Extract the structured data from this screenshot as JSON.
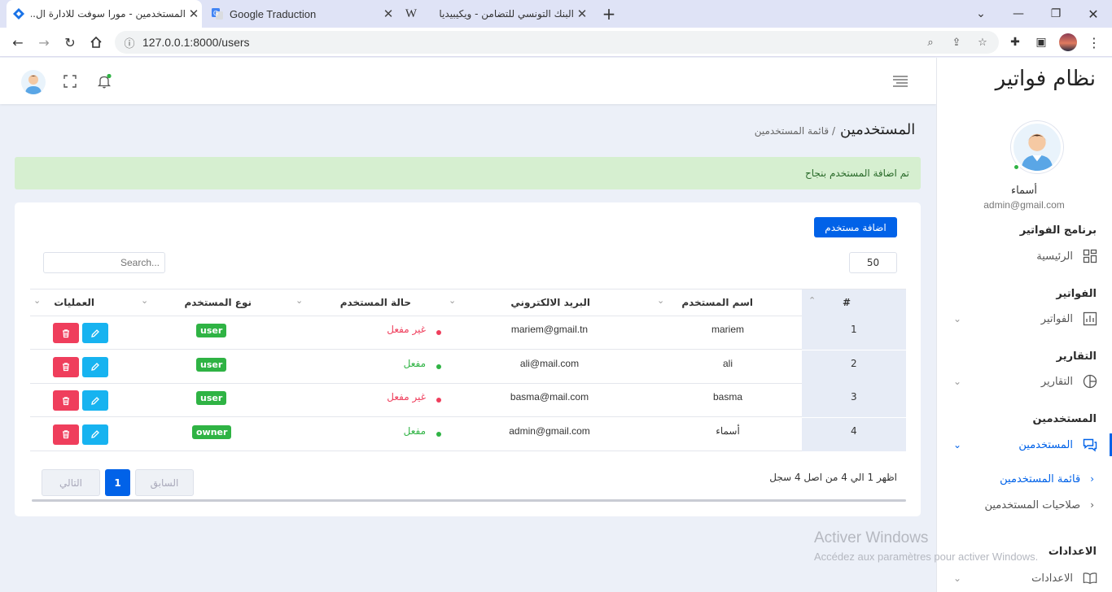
{
  "browser": {
    "tabs": [
      {
        "title": "المستخدمين - مورا سوفت للادارة ال...",
        "icon": "vuexy-logo-icon",
        "active": true
      },
      {
        "title": "Google Traduction",
        "icon": "google-translate-icon",
        "active": false
      },
      {
        "title": "البنك التونسي للتضامن - ويكيبيديا",
        "icon": "wikipedia-icon",
        "active": false
      }
    ],
    "new_tab": "+",
    "url": "127.0.0.1:8000/users"
  },
  "brand": {
    "title": "نظام فواتير"
  },
  "user": {
    "name": "أسماء",
    "email": "admin@gmail.com"
  },
  "sidebar": {
    "sections": [
      {
        "heading": "برنامج الفواتير",
        "items": [
          {
            "label": "الرئيسية",
            "icon": "dashboard-icon"
          }
        ]
      },
      {
        "heading": "الفواتير",
        "items": [
          {
            "label": "الفواتير",
            "icon": "bar-chart-icon"
          }
        ]
      },
      {
        "heading": "التقارير",
        "items": [
          {
            "label": "التقارير",
            "icon": "pie-chart-icon"
          }
        ]
      },
      {
        "heading": "المستخدمين",
        "items": [
          {
            "label": "المستخدمين",
            "icon": "users-icon"
          }
        ]
      },
      {
        "heading": "الاعدادات",
        "items": [
          {
            "label": "الاعدادات",
            "icon": "book-icon"
          }
        ]
      }
    ],
    "sub_items": [
      "قائمة المستخدمين",
      "صلاحيات المستخدمين"
    ]
  },
  "page": {
    "title": "المستخدمين",
    "breadcrumb": "/ قائمة المستخدمين",
    "alert": "تم اضافة المستخدم بنجاح",
    "add_button": "اضافة مستخدم",
    "search_placeholder": "Search...",
    "page_length": "50"
  },
  "table": {
    "headers": [
      "#",
      "اسم المستخدم",
      "البريد الالكتروني",
      "حالة المستخدم",
      "نوع المستخدم",
      "العمليات"
    ],
    "rows": [
      {
        "num": "1",
        "name": "mariem",
        "email": "mariem@gmail.tn",
        "status": "غير مفعل",
        "active": false,
        "role": "user"
      },
      {
        "num": "2",
        "name": "ali",
        "email": "ali@mail.com",
        "status": "مفعل",
        "active": true,
        "role": "user"
      },
      {
        "num": "3",
        "name": "basma",
        "email": "basma@mail.com",
        "status": "غير مفعل",
        "active": false,
        "role": "user"
      },
      {
        "num": "4",
        "name": "أسماء",
        "email": "admin@gmail.com",
        "status": "مفعل",
        "active": true,
        "role": "owner"
      }
    ],
    "info": "اظهر 1 الي 4 من اصل 4 سجل",
    "pagination": {
      "prev": "السابق",
      "current": "1",
      "next": "التالي"
    }
  },
  "watermark": {
    "line1": "Activer Windows",
    "line2": "Accédez aux paramètres pour activer Windows."
  },
  "colors": {
    "primary": "#0162e8",
    "success": "#2fb344",
    "danger": "#ef3e5c",
    "info": "#17b3f0",
    "alert_bg": "#d6efd0"
  }
}
